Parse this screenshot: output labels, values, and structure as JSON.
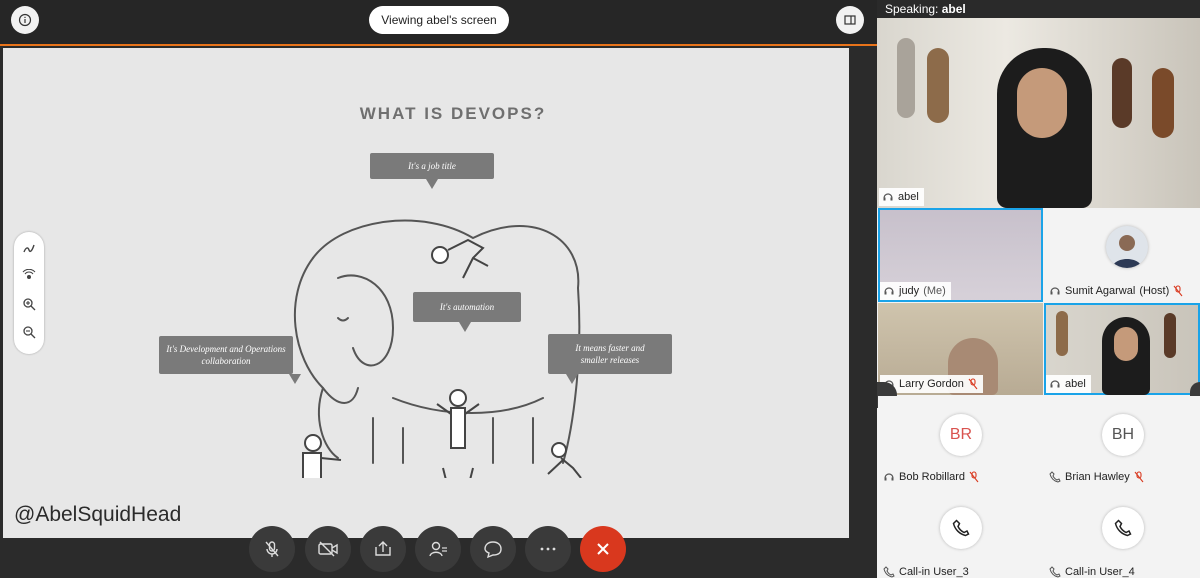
{
  "header": {
    "view_label": "Viewing abel's screen"
  },
  "slide": {
    "title": "WHAT IS DEVOPS?",
    "bubbles": [
      "It's a job title",
      "It's automation",
      "It's Development and Operations collaboration",
      "It means faster and smaller releases"
    ],
    "watermark": "@AbelSquidHead"
  },
  "icons": {
    "info": "info-icon",
    "panel_toggle": "panel-toggle-icon",
    "pen": "pen-icon",
    "laser": "laser-pointer-icon",
    "zoom_in": "zoom-in-icon",
    "zoom_out": "zoom-out-icon"
  },
  "controls": [
    {
      "name": "mute-button",
      "icon": "mic-off-icon"
    },
    {
      "name": "video-button",
      "icon": "camera-icon"
    },
    {
      "name": "share-button",
      "icon": "share-icon"
    },
    {
      "name": "participants-button",
      "icon": "participants-icon"
    },
    {
      "name": "chat-button",
      "icon": "chat-icon"
    },
    {
      "name": "more-button",
      "icon": "more-icon"
    },
    {
      "name": "hang-up-button",
      "icon": "close-icon"
    }
  ],
  "panel": {
    "speaking_label": "Speaking:",
    "speaking_name": "abel",
    "participants": [
      {
        "name": "abel",
        "suffix": ""
      },
      {
        "name": "judy",
        "suffix": "(Me)"
      },
      {
        "name": "Sumit Agarwal",
        "suffix": "(Host)"
      },
      {
        "name": "Larry Gordon",
        "suffix": ""
      },
      {
        "name": "abel",
        "suffix": ""
      },
      {
        "name": "Bob Robillard",
        "initials": "BR"
      },
      {
        "name": "Brian Hawley",
        "initials": "BH"
      },
      {
        "name": "Call-in User_3"
      },
      {
        "name": "Call-in User_4"
      }
    ]
  },
  "colors": {
    "accent": "#e8731a",
    "active_border": "#1aa3e8",
    "end_call": "#d9381e",
    "initials_br": "#d9534f",
    "initials_bh": "#555555"
  }
}
